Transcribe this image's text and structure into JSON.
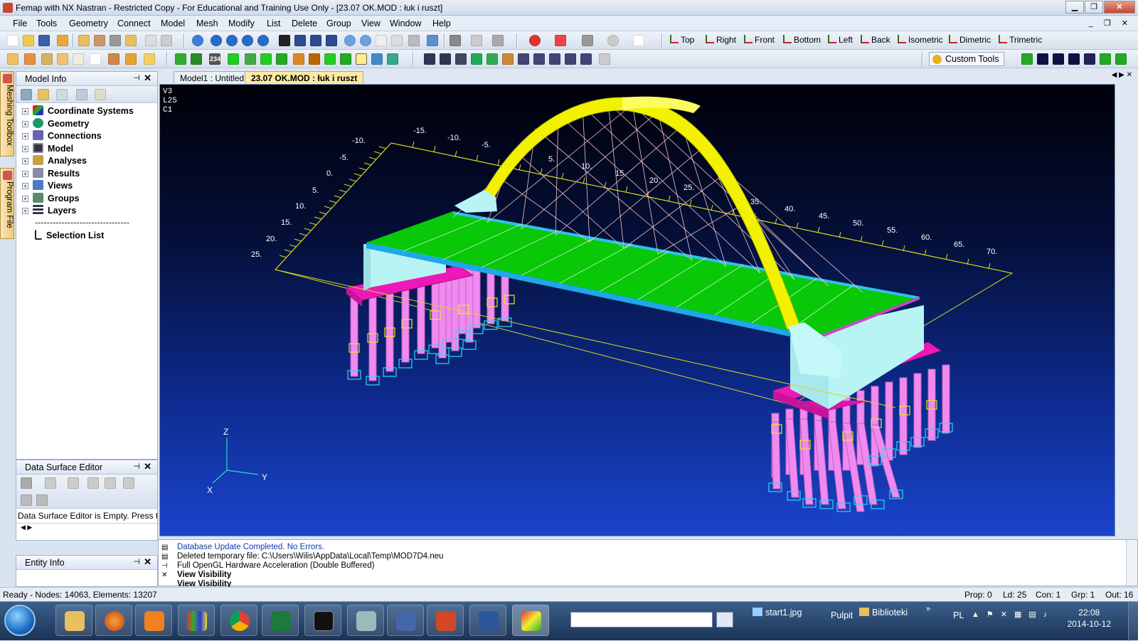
{
  "window": {
    "title": "Femap with NX Nastran - Restricted Copy - For Educational and Training Use Only - [23.07 OK.MOD : łuk i ruszt]",
    "background_title": "Pulpit"
  },
  "menu": [
    "File",
    "Tools",
    "Geometry",
    "Connect",
    "Model",
    "Mesh",
    "Modify",
    "List",
    "Delete",
    "Group",
    "View",
    "Window",
    "Help"
  ],
  "view_buttons": [
    "Top",
    "Right",
    "Front",
    "Bottom",
    "Left",
    "Back",
    "Isometric",
    "Dimetric",
    "Trimetric"
  ],
  "custom_tools_label": "Custom Tools",
  "side_tabs": [
    "Meshing Toolbox",
    "Program File"
  ],
  "model_info": {
    "title": "Model Info",
    "tree": [
      "Coordinate Systems",
      "Geometry",
      "Connections",
      "Model",
      "Analyses",
      "Results",
      "Views",
      "Groups",
      "Layers"
    ],
    "separator": "--------------------------------",
    "selection_list": "Selection List"
  },
  "data_surface": {
    "title": "Data Surface Editor",
    "message": "Data Surface Editor is Empty. Press t..."
  },
  "entity_info": {
    "title": "Entity Info"
  },
  "doc_tabs": [
    {
      "label": "Model1 : Untitled",
      "active": false
    },
    {
      "label": "23.07 OK.MOD : łuk i ruszt",
      "active": true
    }
  ],
  "viewport": {
    "labels": [
      "V3",
      "L25",
      "C1"
    ],
    "triad": {
      "z": "Z",
      "y": "Y",
      "x": "X"
    },
    "ruler_left": [
      "-10.",
      "-5.",
      "0.",
      "5.",
      "10.",
      "15.",
      "20.",
      "25."
    ],
    "ruler_top": [
      "-15.",
      "-10.",
      "-5.",
      "5.",
      "10.",
      "15.",
      "20.",
      "25.",
      "35.",
      "40.",
      "45.",
      "50.",
      "55.",
      "60.",
      "65.",
      "70."
    ],
    "colors": {
      "background_top": "#000008",
      "background_bottom": "#1a44cc",
      "deck": "#08c808",
      "arch": "#f2f200",
      "abutment": "#b8f4f4",
      "pile_cap": "#ee18b8",
      "piles": "#f08af0",
      "cables": "#f4c8c8"
    }
  },
  "messages": [
    "Database Update Completed. No Errors.",
    "Deleted temporary file: C:\\Users\\Wilis\\AppData\\Local\\Temp\\MOD7D4.neu",
    "Full OpenGL Hardware Acceleration (Double Buffered)",
    "View Visibility",
    "View Visibility"
  ],
  "status": {
    "left": "Ready - Nodes: 14063,  Elements: 13207",
    "prop": "Prop: 0",
    "ld": "Ld: 25",
    "con": "Con: 1",
    "grp": "Grp: 1",
    "out": "Out: 16"
  },
  "taskbar": {
    "start1": "start1.jpg",
    "pulpit": "Pulpit",
    "biblioteki": "Biblioteki",
    "lang": "PL",
    "time": "22:08",
    "date": "2014-10-12"
  }
}
